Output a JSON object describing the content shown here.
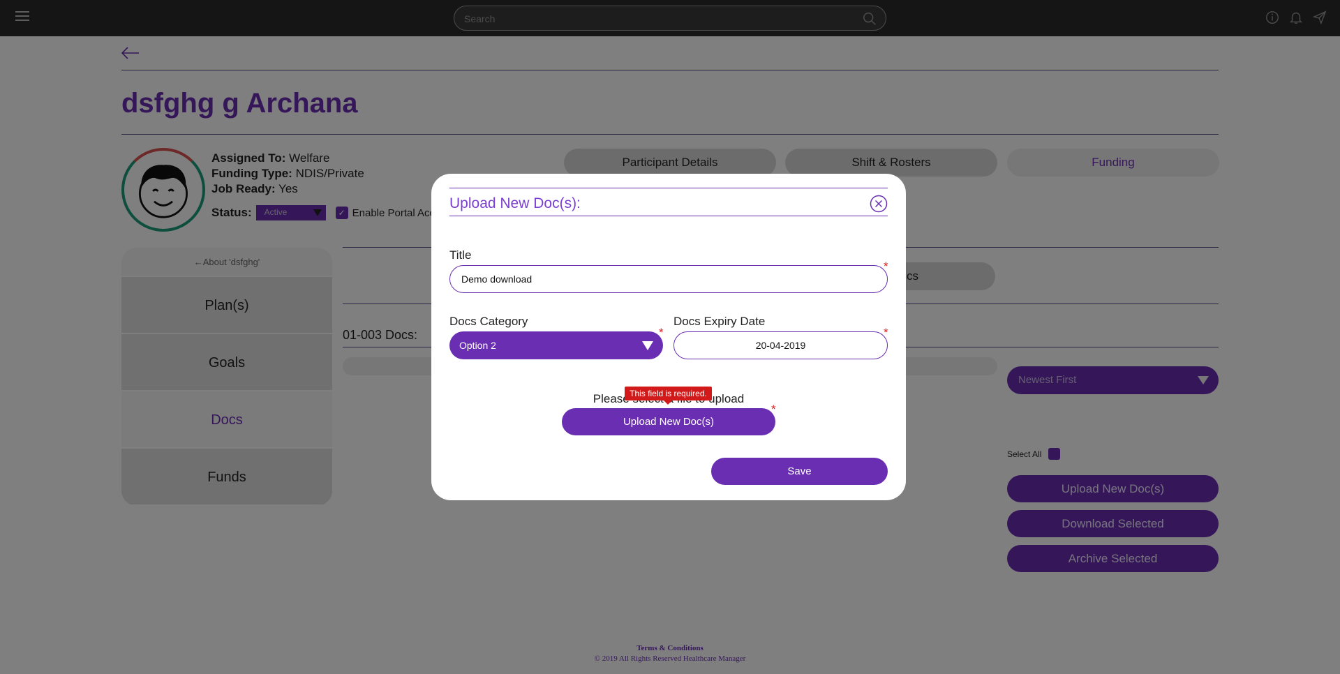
{
  "topbar": {
    "search_placeholder": "Search"
  },
  "person": {
    "name": "dsfghg g Archana",
    "assigned_to_label": "Assigned To:",
    "assigned_to": " Welfare",
    "funding_type_label": "Funding Type:",
    "funding_type": " NDIS/Private",
    "job_ready_label": "Job Ready:",
    "job_ready": " Yes",
    "status_label": "Status:",
    "status_value": "Active",
    "portal_access_label": "Enable Portal Acce"
  },
  "tabs": [
    {
      "label": "Participant Details"
    },
    {
      "label": "Shift & Rosters"
    },
    {
      "label": "Funding"
    }
  ],
  "sub_tab": {
    "label": "cs"
  },
  "docs_count_label": "01-003 Docs:",
  "sidebar": {
    "about": "About 'dsfghg'",
    "items": [
      {
        "label": "Plan(s)"
      },
      {
        "label": "Goals"
      },
      {
        "label": "Docs"
      },
      {
        "label": "Funds"
      }
    ]
  },
  "right_panel": {
    "sort_value": "Newest First",
    "select_all_label": "Select All",
    "upload_label": "Upload New Doc(s)",
    "download_label": "Download Selected",
    "archive_label": "Archive Selected"
  },
  "footer": {
    "terms": "Terms & Conditions",
    "copyright": "© 2019 All Rights Reserved Healthcare Manager"
  },
  "modal": {
    "title": "Upload New Doc(s):",
    "title_field_label": "Title",
    "title_value": "Demo download",
    "category_label": "Docs Category",
    "category_value": "Option 2",
    "expiry_label": "Docs Expiry Date",
    "expiry_value": "20-04-2019",
    "select_file_label": "Please select a file to upload",
    "tooltip": "This field is required.",
    "upload_button": "Upload New Doc(s)",
    "save_button": "Save",
    "required_mark": "*"
  },
  "colors": {
    "accent": "#6a2eb3",
    "topbar": "#2b2b2b",
    "error": "#d21a1a"
  }
}
